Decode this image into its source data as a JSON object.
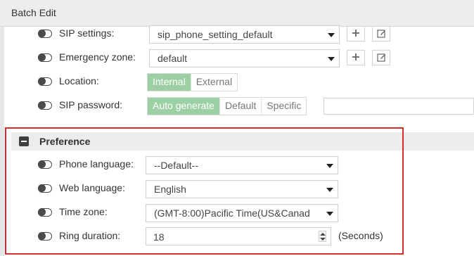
{
  "window": {
    "title": "Batch Edit"
  },
  "fields": {
    "sip_settings": {
      "label": "SIP settings:",
      "value": "sip_phone_setting_default"
    },
    "emergency_zone": {
      "label": "Emergency zone:",
      "value": "default"
    },
    "location": {
      "label": "Location:",
      "options": [
        "Internal",
        "External"
      ],
      "selected": "Internal"
    },
    "sip_password": {
      "label": "SIP password:",
      "options": [
        "Auto generate",
        "Default",
        "Specific"
      ],
      "selected": "Auto generate",
      "value": ""
    }
  },
  "preference": {
    "title": "Preference",
    "phone_language": {
      "label": "Phone language:",
      "value": "--Default--"
    },
    "web_language": {
      "label": "Web language:",
      "value": "English"
    },
    "time_zone": {
      "label": "Time zone:",
      "value": "(GMT-8:00)Pacific Time(US&Canad"
    },
    "ring_duration": {
      "label": "Ring duration:",
      "value": "18",
      "unit": "(Seconds)"
    }
  },
  "icons": {
    "add": "plus-icon",
    "edit": "edit-icon",
    "collapse": "minus-icon",
    "dropdown": "caret-down-icon"
  },
  "colors": {
    "segment_active": "#9ccfa3",
    "highlight_border": "#d62c2c",
    "section_header_bg": "#ececec"
  }
}
